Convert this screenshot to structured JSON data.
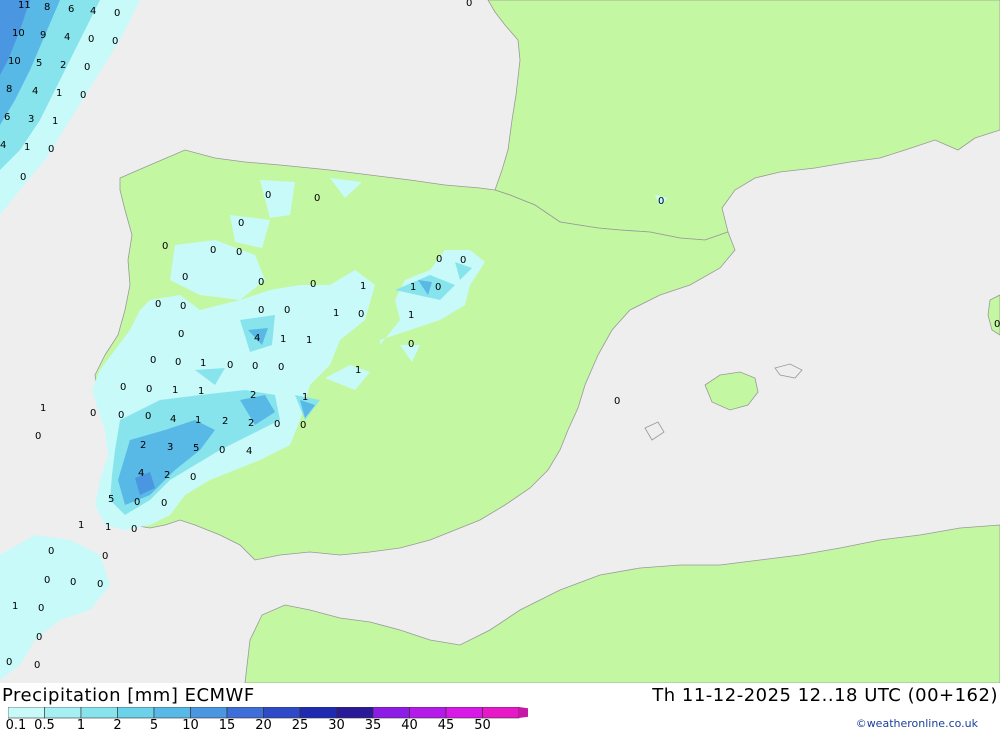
{
  "header": {
    "title": "Precipitation [mm] ECMWF",
    "valid_time": "Th 11-12-2025 12..18 UTC (00+162)"
  },
  "legend": {
    "labels": [
      "0.1",
      "0.5",
      "1",
      "2",
      "5",
      "10",
      "15",
      "20",
      "25",
      "30",
      "35",
      "40",
      "45",
      "50"
    ],
    "colors": [
      "#c8fafa",
      "#a6eff2",
      "#88e4ec",
      "#6cd2ea",
      "#58b8e6",
      "#4a96e0",
      "#3e6fd8",
      "#2f4ac6",
      "#1e2bb0",
      "#2a1a98",
      "#8c1ce6",
      "#b41ae8",
      "#d818e6",
      "#e618c8",
      "#c818a8"
    ]
  },
  "credit": "©weatheronline.co.uk",
  "colors": {
    "land": "#c4f7a2",
    "sea": "#eeeeee",
    "border": "#999999"
  },
  "map_labels": [
    "11",
    "8",
    "6",
    "4",
    "0",
    "10",
    "9",
    "4",
    "0",
    "0",
    "10",
    "5",
    "2",
    "0",
    "8",
    "4",
    "1",
    "0",
    "6",
    "3",
    "1",
    "4",
    "1",
    "0",
    "0",
    "0",
    "0",
    "0",
    "0",
    "0",
    "0",
    "0",
    "0",
    "0",
    "0",
    "0",
    "0",
    "1",
    "1",
    "0",
    "0",
    "0",
    "0",
    "4",
    "1",
    "1",
    "0",
    "1",
    "0",
    "0",
    "1",
    "0",
    "0",
    "1",
    "0",
    "0",
    "1",
    "1",
    "0",
    "0",
    "1",
    "0",
    "0",
    "0",
    "0",
    "4",
    "1",
    "2",
    "2",
    "0",
    "0",
    "1",
    "0",
    "2",
    "2",
    "3",
    "5",
    "0",
    "4",
    "4",
    "2",
    "0",
    "5",
    "0",
    "0",
    "1",
    "1",
    "0",
    "1",
    "0",
    "0",
    "0",
    "0",
    "0",
    "0",
    "1",
    "0",
    "0",
    "0",
    "0"
  ]
}
